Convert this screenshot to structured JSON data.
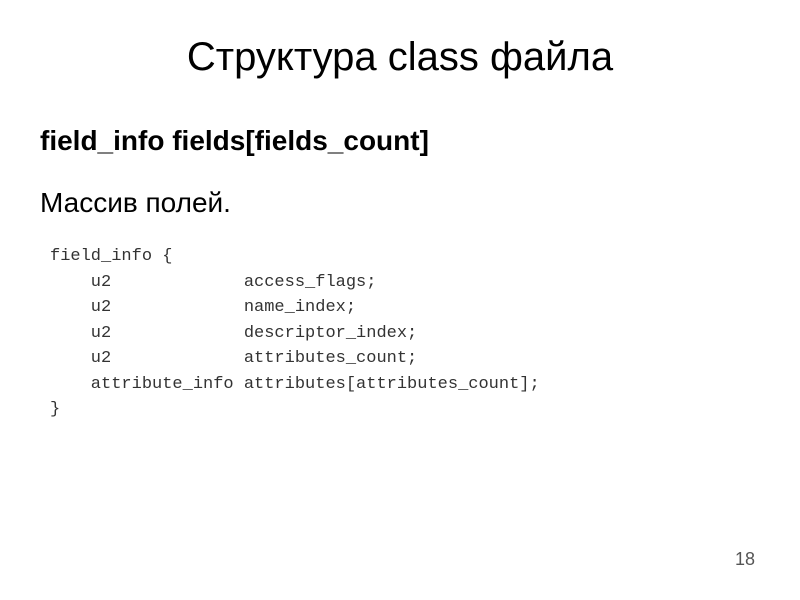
{
  "title": "Структура class файла",
  "subheading": "field_info fields[fields_count]",
  "description": "Массив полей.",
  "code": {
    "line1": "field_info {",
    "line2": "    u2             access_flags;",
    "line3": "    u2             name_index;",
    "line4": "    u2             descriptor_index;",
    "line5": "    u2             attributes_count;",
    "line6": "    attribute_info attributes[attributes_count];",
    "line7": "}"
  },
  "page_number": "18"
}
